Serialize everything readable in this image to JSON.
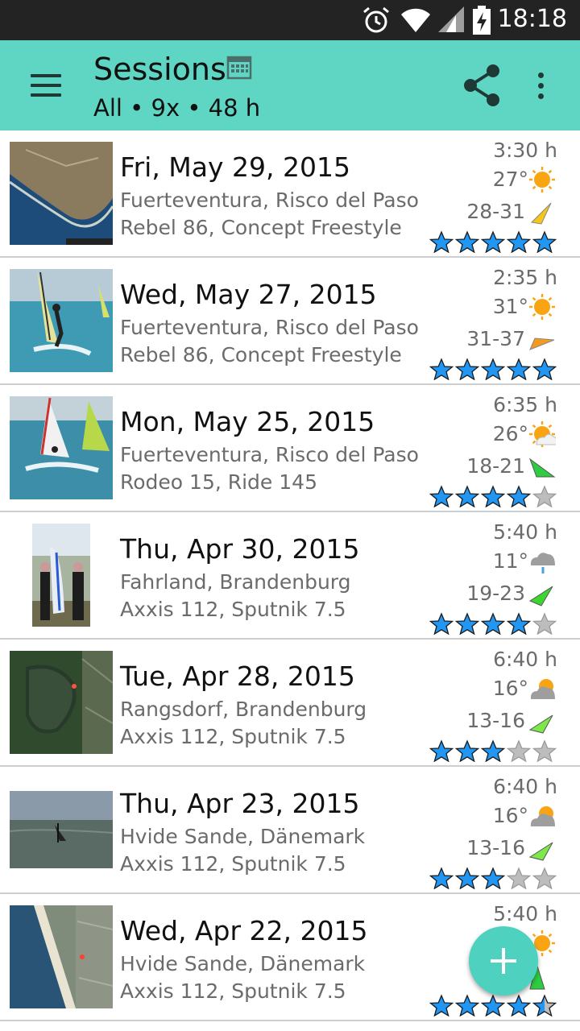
{
  "status_bar": {
    "time": "18:18",
    "icons": [
      "alarm-icon",
      "wifi-icon",
      "signal-icon",
      "battery-charging-icon"
    ]
  },
  "app_bar": {
    "title": "Sessions",
    "subtitle": "All • 9x • 48 h",
    "icons": [
      "menu-icon",
      "calendar-icon",
      "share-icon",
      "overflow-menu-icon"
    ]
  },
  "sessions": [
    {
      "date": "Fri, May 29, 2015",
      "location": "Fuerteventura, Risco del Paso",
      "gear": "Rebel 86, Concept Freestyle",
      "duration": "3:30 h",
      "temperature": "27°",
      "weather": "sunny",
      "wind": "28-31",
      "wind_color": "#f5c518",
      "rating": 5,
      "thumbnail": "map-satellite-coast"
    },
    {
      "date": "Wed, May 27, 2015",
      "location": "Fuerteventura, Risco del Paso",
      "gear": "Rebel 86, Concept Freestyle",
      "duration": "2:35 h",
      "temperature": "31°",
      "weather": "sunny",
      "wind": "31-37",
      "wind_color": "#f59a1a",
      "rating": 5,
      "thumbnail": "windsurfer-photo"
    },
    {
      "date": "Mon, May 25, 2015",
      "location": "Fuerteventura, Risco del Paso",
      "gear": "Rodeo 15, Ride 145",
      "duration": "6:35 h",
      "temperature": "26°",
      "weather": "partly-cloudy",
      "wind": "18-21",
      "wind_color": "#2ecc40",
      "rating": 4,
      "thumbnail": "windsurfers-photo"
    },
    {
      "date": "Thu, Apr 30, 2015",
      "location": "Fahrland, Brandenburg",
      "gear": "Axxis 112, Sputnik 7.5",
      "duration": "5:40 h",
      "temperature": "11°",
      "weather": "rain",
      "wind": "19-23",
      "wind_color": "#3dd62f",
      "rating": 4,
      "thumbnail": "people-portrait-photo"
    },
    {
      "date": "Tue, Apr 28, 2015",
      "location": "Rangsdorf, Brandenburg",
      "gear": "Axxis 112, Sputnik 7.5",
      "duration": "6:40 h",
      "temperature": "16°",
      "weather": "cloudy-sun",
      "wind": "13-16",
      "wind_color": "#7de84a",
      "rating": 3,
      "thumbnail": "map-satellite-lake"
    },
    {
      "date": "Thu, Apr 23, 2015",
      "location": "Hvide Sande, Dänemark",
      "gear": "Axxis 112, Sputnik 7.5",
      "duration": "6:40 h",
      "temperature": "16°",
      "weather": "cloudy-sun",
      "wind": "13-16",
      "wind_color": "#7de84a",
      "rating": 3,
      "thumbnail": "sea-photo"
    },
    {
      "date": "Wed, Apr 22, 2015",
      "location": "Hvide Sande, Dänemark",
      "gear": "Axxis 112, Sputnik 7.5",
      "duration": "5:40 h",
      "temperature": "",
      "weather": "sunny",
      "wind": "",
      "wind_color": "#2ecc40",
      "rating": 4.5,
      "thumbnail": "map-satellite-town"
    }
  ],
  "fab": {
    "icon": "add-icon"
  },
  "colors": {
    "accent": "#5fd6c3",
    "fab": "#4fd1bf",
    "star_filled": "#2196f3",
    "star_empty": "#bdbdbd"
  }
}
